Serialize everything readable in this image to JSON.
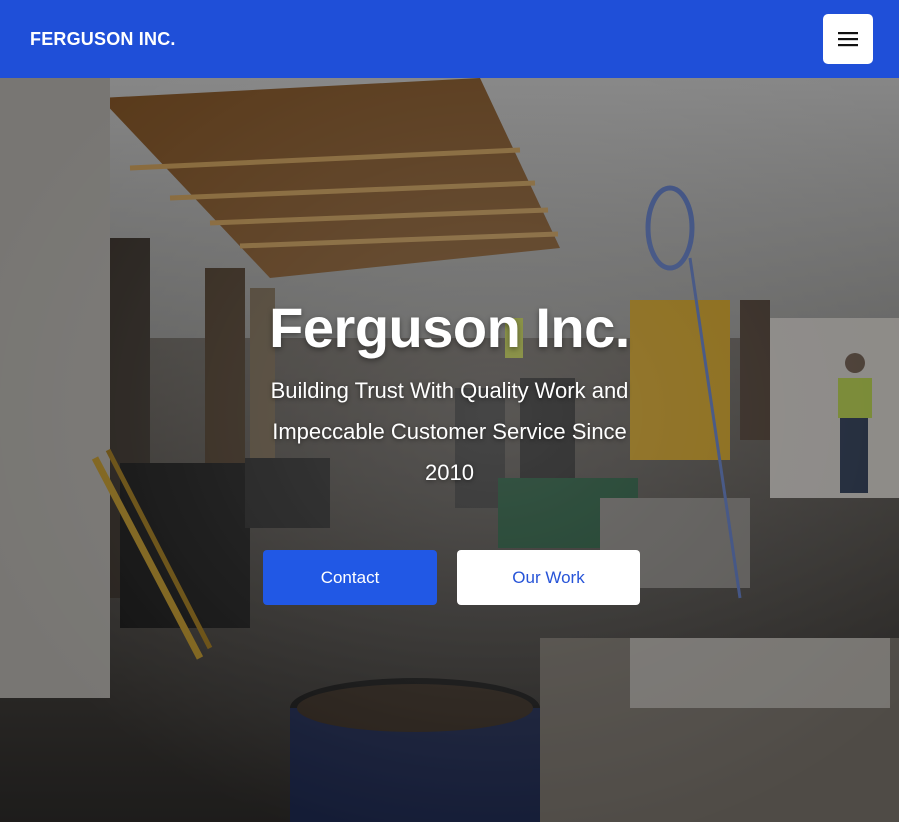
{
  "header": {
    "brand": "FERGUSON INC.",
    "menu_icon": "hamburger-menu-icon",
    "background_color": "#1f4fd8"
  },
  "hero": {
    "title": "Ferguson Inc.",
    "subtitle": "Building Trust With Quality Work and Impeccable Customer Service Since 2010",
    "background_description_icon": "construction-site-photo",
    "buttons": {
      "contact_label": "Contact",
      "our_work_label": "Our Work"
    }
  },
  "colors": {
    "accent": "#2158e5",
    "secondary_button_text": "#2754d8"
  }
}
